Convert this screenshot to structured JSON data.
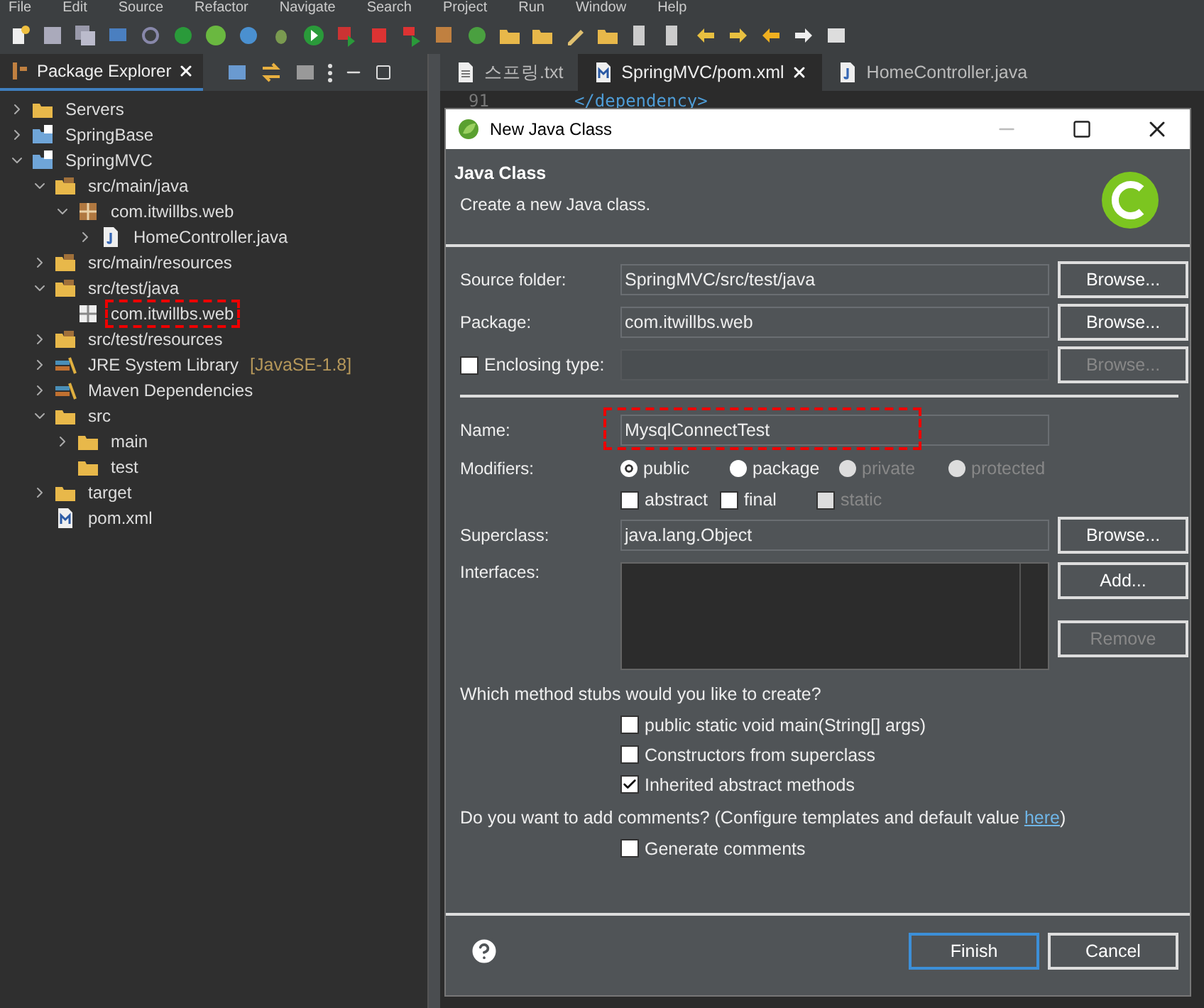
{
  "menu": [
    "File",
    "Edit",
    "Source",
    "Refactor",
    "Navigate",
    "Search",
    "Project",
    "Run",
    "Window",
    "Help"
  ],
  "explorer": {
    "title": "Package Explorer",
    "tree": [
      {
        "label": "Servers",
        "kind": "folder",
        "expanded": false,
        "marked": false
      },
      {
        "label": "SpringBase",
        "kind": "project",
        "expanded": false,
        "marked": false
      },
      {
        "label": "SpringMVC",
        "kind": "project",
        "expanded": true,
        "marked": false,
        "children": [
          {
            "label": "src/main/java",
            "kind": "source",
            "expanded": true,
            "marked": false,
            "children": [
              {
                "label": "com.itwillbs.web",
                "kind": "package",
                "expanded": true,
                "marked": false,
                "children": [
                  {
                    "label": "HomeController.java",
                    "kind": "java",
                    "expanded": false,
                    "marked": false
                  }
                ]
              }
            ]
          },
          {
            "label": "src/main/resources",
            "kind": "source",
            "expanded": false,
            "marked": false
          },
          {
            "label": "src/test/java",
            "kind": "source",
            "expanded": true,
            "marked": false,
            "children": [
              {
                "label": "com.itwillbs.web",
                "kind": "empty-package",
                "marked": true
              }
            ]
          },
          {
            "label": "src/test/resources",
            "kind": "source",
            "expanded": false,
            "marked": false
          },
          {
            "label": "JRE System Library",
            "suffix": "[JavaSE-1.8]",
            "kind": "library",
            "expanded": false,
            "marked": false
          },
          {
            "label": "Maven Dependencies",
            "kind": "library",
            "expanded": false,
            "marked": false
          },
          {
            "label": "src",
            "kind": "folder",
            "expanded": true,
            "marked": false,
            "children": [
              {
                "label": "main",
                "kind": "folder",
                "expanded": false,
                "marked": false
              },
              {
                "label": "test",
                "kind": "folder",
                "marked": false
              }
            ]
          },
          {
            "label": "target",
            "kind": "folder",
            "expanded": false,
            "marked": false
          },
          {
            "label": "pom.xml",
            "kind": "pom",
            "marked": false
          }
        ]
      }
    ]
  },
  "editor_tabs": [
    {
      "label": "스프링.txt",
      "kind": "text",
      "selected": false,
      "closable": false
    },
    {
      "label": "SpringMVC/pom.xml",
      "kind": "pom",
      "selected": true,
      "closable": true
    },
    {
      "label": "HomeController.java",
      "kind": "java",
      "selected": false,
      "closable": false
    }
  ],
  "editor": {
    "top_line": {
      "number": "91",
      "code": "</dependency>"
    }
  },
  "dialog": {
    "title": "New Java Class",
    "heading": "Java Class",
    "description": "Create a new Java class.",
    "rows": [
      {
        "kind": "field",
        "label": "Source folder:",
        "value": "SpringMVC/src/test/java",
        "marked": false,
        "button": {
          "label": "Browse...",
          "disabled": false
        }
      },
      {
        "kind": "field",
        "label": "Package:",
        "value": "com.itwillbs.web",
        "marked": false,
        "button": {
          "label": "Browse...",
          "disabled": false
        }
      },
      {
        "kind": "check-field",
        "label": "Enclosing type:",
        "checked": false,
        "disabled": true,
        "button": {
          "label": "Browse...",
          "disabled": true
        }
      },
      {
        "kind": "separator"
      },
      {
        "kind": "field",
        "label": "Name:",
        "value": "MysqlConnectTest",
        "marked": true
      },
      {
        "kind": "radios",
        "label": "Modifiers:",
        "options": [
          {
            "label": "public",
            "selected": true,
            "disabled": false
          },
          {
            "label": "package",
            "selected": false,
            "disabled": false
          },
          {
            "label": "private",
            "selected": false,
            "disabled": true
          },
          {
            "label": "protected",
            "selected": false,
            "disabled": true
          }
        ]
      },
      {
        "kind": "checks",
        "options": [
          {
            "label": "abstract",
            "checked": false,
            "disabled": false
          },
          {
            "label": "final",
            "checked": false,
            "disabled": false
          },
          {
            "label": "static",
            "checked": false,
            "disabled": true
          }
        ]
      },
      {
        "kind": "field",
        "label": "Superclass:",
        "value": "java.lang.Object",
        "marked": false,
        "button": {
          "label": "Browse...",
          "disabled": false
        }
      },
      {
        "kind": "list",
        "label": "Interfaces:",
        "buttons": [
          {
            "label": "Add...",
            "disabled": false
          },
          {
            "label": "Remove",
            "disabled": true
          }
        ]
      },
      {
        "kind": "text",
        "text": "Which method stubs would you like to create?"
      },
      {
        "kind": "check",
        "label": "public static void main(String[] args)",
        "checked": false
      },
      {
        "kind": "check",
        "label": "Constructors from superclass",
        "checked": false
      },
      {
        "kind": "check",
        "label": "Inherited abstract methods",
        "checked": true
      },
      {
        "kind": "link-text",
        "text": "Do you want to add comments? (Configure templates and default value ",
        "link": "here",
        "after": ")"
      },
      {
        "kind": "check",
        "label": "Generate comments",
        "checked": false
      }
    ],
    "buttons": [
      {
        "label": "Finish",
        "default": true
      },
      {
        "label": "Cancel",
        "default": false
      }
    ]
  }
}
